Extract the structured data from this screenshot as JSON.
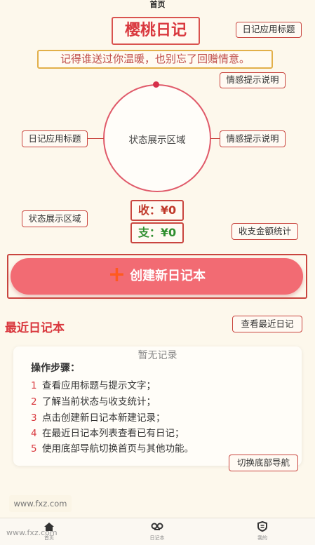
{
  "header": {
    "title": "首页"
  },
  "app_title": "樱桃日记",
  "subtitle": "记得谁送过你温暖，也别忘了回赠情意。",
  "annotations": {
    "app_title_tag": "日记应用标题",
    "emotion_tag_top": "情感提示说明",
    "left_tag": "日记应用标题",
    "right_tag": "情感提示说明",
    "status_area_tag": "状态展示区域",
    "stats_tag": "收支金额统计",
    "recent_tag": "查看最近日记",
    "nav_tag": "切换底部导航"
  },
  "status_area": {
    "label": "状态展示区域"
  },
  "stats": {
    "income": "收：¥0",
    "expense": "支：¥0"
  },
  "create_button": {
    "icon": "plus-icon",
    "label": "创建新日记本"
  },
  "recent": {
    "title": "最近日记本",
    "empty_text": "暂无记录",
    "steps_title": "操作步骤：",
    "steps": [
      {
        "num": "1",
        "text": "查看应用标题与提示文字；"
      },
      {
        "num": "2",
        "text": "了解当前状态与收支统计；"
      },
      {
        "num": "3",
        "text": "点击创建新日记本新建记录；"
      },
      {
        "num": "4",
        "text": "在最近日记本列表查看已有日记；"
      },
      {
        "num": "5",
        "text": "使用底部导航切换首页与其他功能。"
      }
    ]
  },
  "watermark": {
    "box": "www.fxz.com",
    "bottom": "www.fxz.com"
  },
  "tabbar": {
    "items": [
      {
        "icon": "home-icon",
        "label": "首页"
      },
      {
        "icon": "tape-icon",
        "label": "日记本"
      },
      {
        "icon": "badge-icon",
        "label": "我的"
      }
    ]
  },
  "colors": {
    "accent": "#d9383e",
    "button": "#f26b73",
    "background": "#fdf8ec",
    "income": "#c0392b",
    "expense": "#2f8f2f"
  }
}
